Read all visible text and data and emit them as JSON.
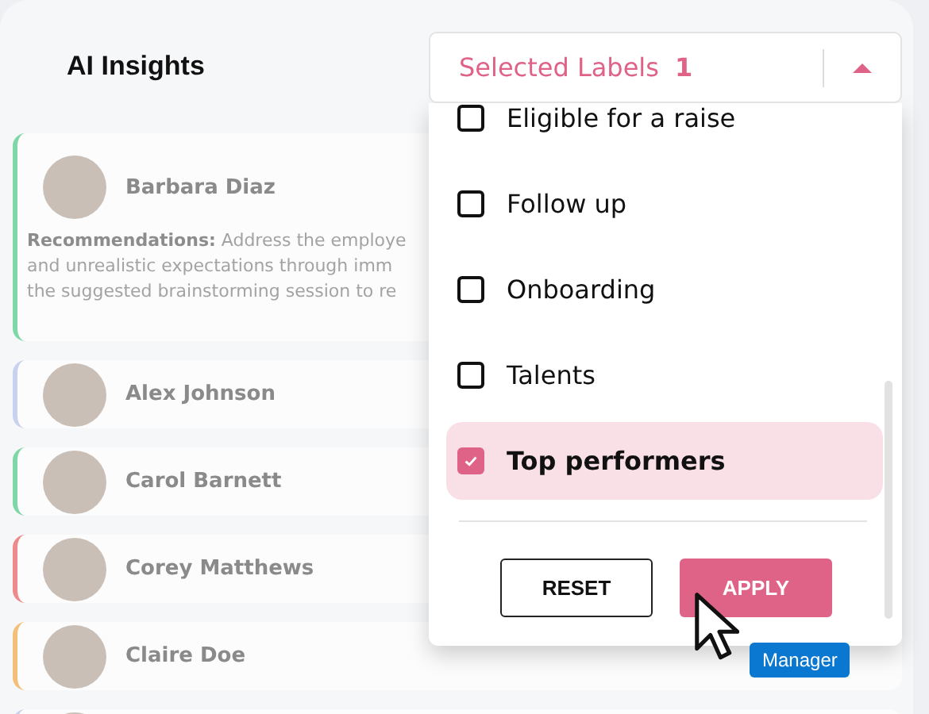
{
  "title": "AI Insights",
  "employees": [
    {
      "name": "Barbara Diaz",
      "color": "#7fd6a6",
      "recommendation": {
        "label": "Recommendations:",
        "lines": [
          "Address the employe",
          "and unrealistic expectations through imm",
          "the suggested brainstorming session to re"
        ]
      }
    },
    {
      "name": "Alex Johnson",
      "color": "#c8d2ee"
    },
    {
      "name": "Carol Barnett",
      "color": "#7fd6a6"
    },
    {
      "name": "Corey Matthews",
      "color": "#ee8a8a"
    },
    {
      "name": "Claire Doe",
      "color": "#f3c07a"
    },
    {
      "color": "#c8d2ee"
    }
  ],
  "label_filter": {
    "title": "Selected Labels",
    "count": "1",
    "expanded": true,
    "options": [
      {
        "label": "Eligible for a raise",
        "checked": false
      },
      {
        "label": "Follow up",
        "checked": false
      },
      {
        "label": "Onboarding",
        "checked": false
      },
      {
        "label": "Talents",
        "checked": false
      },
      {
        "label": "Top performers",
        "checked": true
      }
    ],
    "buttons": [
      {
        "label": "RESET",
        "kind": "secondary"
      },
      {
        "label": "APPLY",
        "kind": "primary"
      }
    ]
  },
  "cursor_tag": "Manager"
}
